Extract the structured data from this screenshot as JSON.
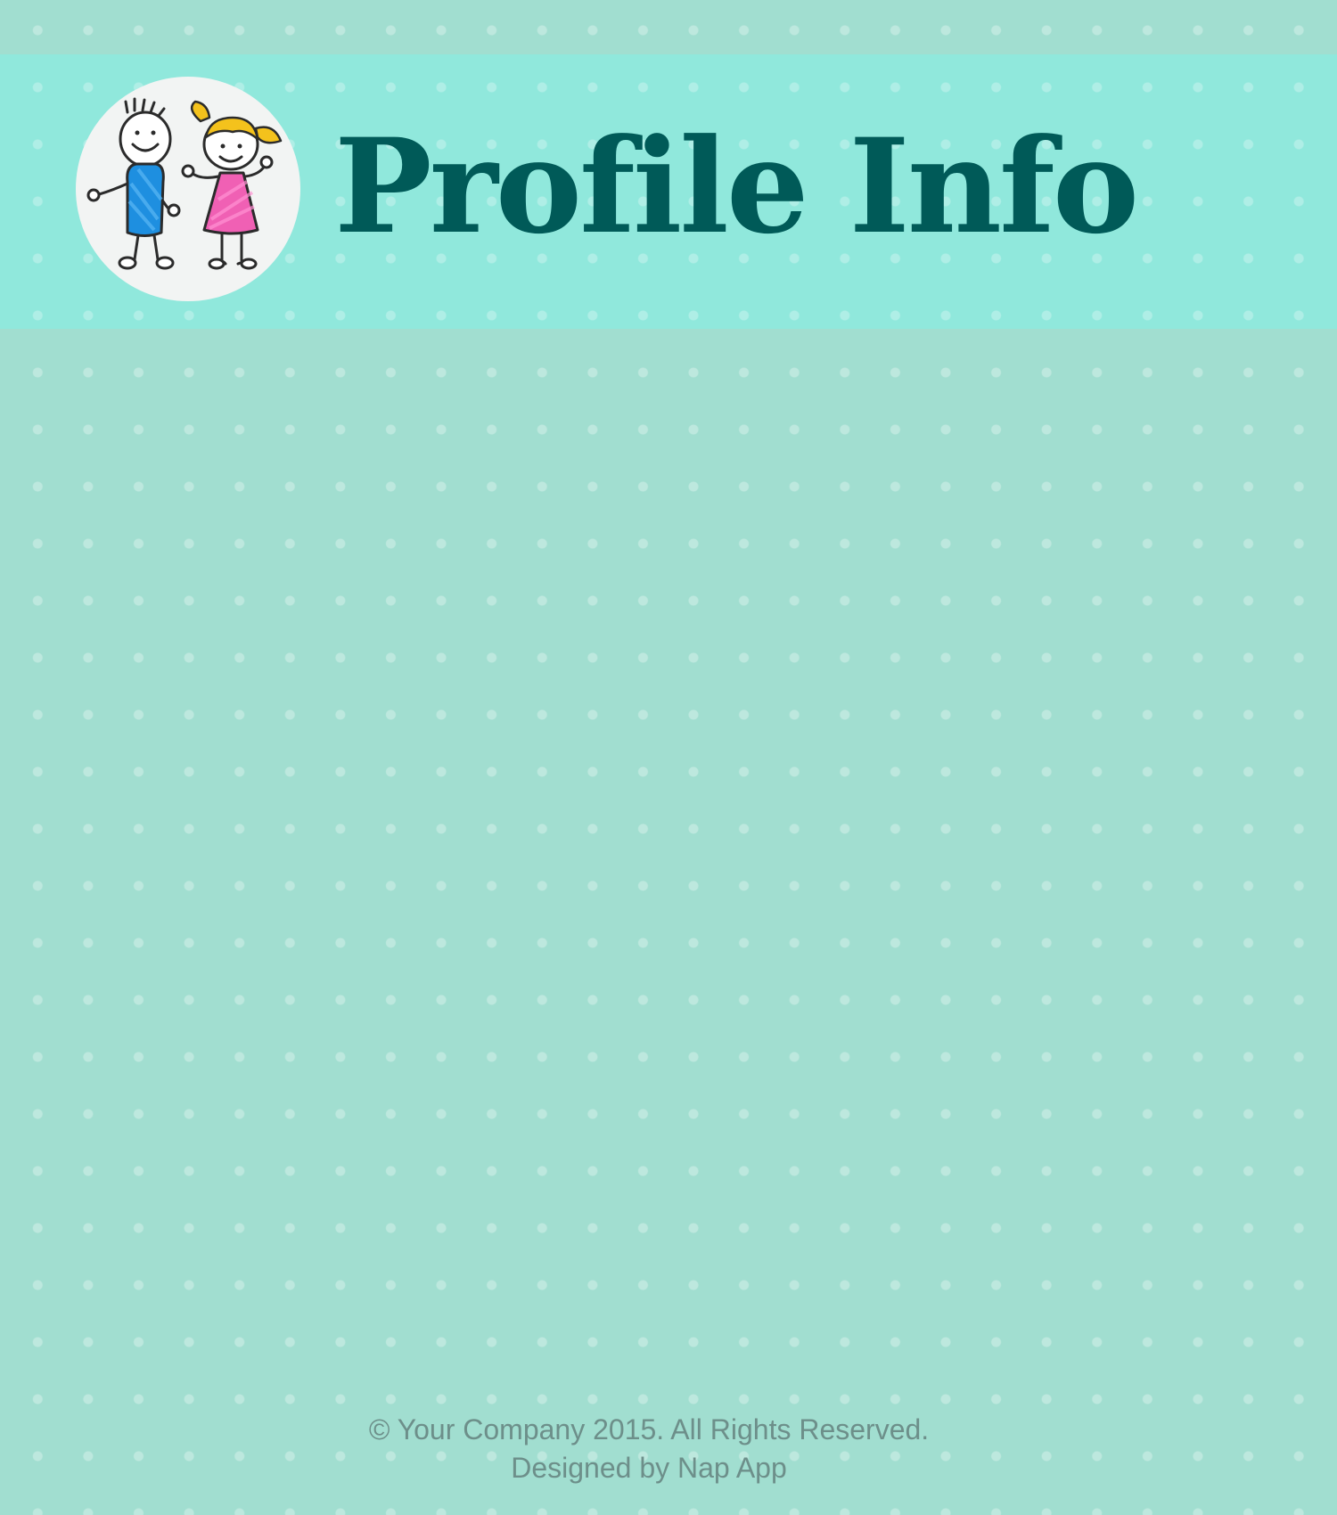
{
  "header": {
    "title": "Profile Info",
    "avatar_alt": "kids-illustration"
  },
  "footer": {
    "copyright": "© Your Company 2015. All Rights Reserved.",
    "credit": "Designed by Nap App"
  },
  "colors": {
    "page_background": "#a1ded0",
    "header_band": "#90e8dc",
    "title_text": "#005a58",
    "footer_text": "#6d8f8a",
    "avatar_background": "#f2f4f3",
    "boy_shirt": "#1e8fe0",
    "girl_dress": "#f060b4",
    "girl_hair": "#f4c21c"
  }
}
